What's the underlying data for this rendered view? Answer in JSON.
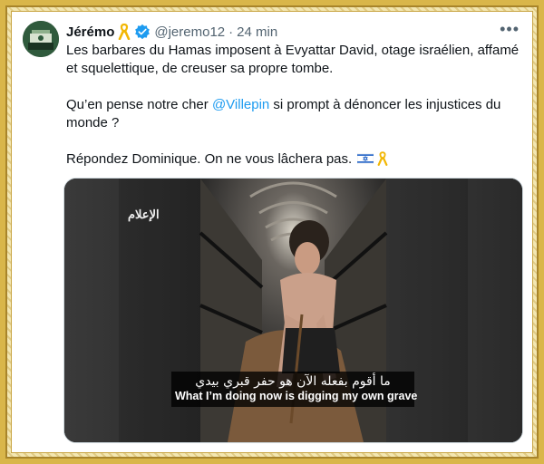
{
  "tweet": {
    "author_name": "Jérémo",
    "handle": "@jeremo12",
    "separator": "·",
    "time": "24 min",
    "more_label": "•••",
    "paragraph1": "Les barbares du Hamas imposent à Evyattar David, otage israélien, affamé et squelettique, de creuser sa propre tombe.",
    "paragraph2_before": "Qu’en pense notre cher ",
    "paragraph2_mention": "@Villepin",
    "paragraph2_after": " si prompt à dénoncer les injustices du monde ?",
    "paragraph3": "Répondez Dominique. On ne vous lâchera pas.",
    "emoji_icons": [
      "israel-flag-icon",
      "yellow-ribbon-icon"
    ]
  },
  "media": {
    "watermark": "الإعلام",
    "subtitle_arabic": "ما أقوم بفعله الآن هو حفر قبري بيدي",
    "subtitle_english": "What I’m doing now is digging my own grave"
  },
  "colors": {
    "link": "#1d9bf0",
    "verified": "#1d9bf0",
    "ribbon": "#f2b705",
    "text": "#0f1419",
    "muted": "#536471",
    "frame": "#d9b64a"
  }
}
